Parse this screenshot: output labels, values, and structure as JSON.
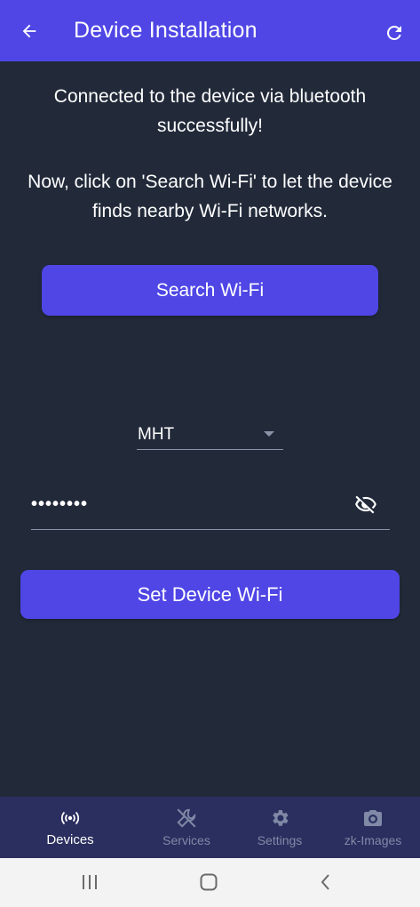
{
  "header": {
    "title": "Device Installation",
    "back_icon": "arrow-left-icon",
    "refresh_icon": "refresh-icon"
  },
  "message": {
    "line1": "Connected to the device via bluetooth successfully!",
    "line2": "Now, click on 'Search Wi-Fi' to let the device finds nearby Wi-Fi networks."
  },
  "search_button": {
    "label": "Search Wi-Fi"
  },
  "network_select": {
    "selected": "MHT"
  },
  "password": {
    "value": "••••••••",
    "visibility_icon": "eye-off-icon"
  },
  "set_button": {
    "label": "Set Device Wi-Fi"
  },
  "bottom_nav": {
    "items": [
      {
        "label": "Devices",
        "icon": "broadcast-icon",
        "active": true
      },
      {
        "label": "Services",
        "icon": "tools-icon",
        "active": false
      },
      {
        "label": "Settings",
        "icon": "gear-icon",
        "active": false
      },
      {
        "label": "zk-Images",
        "icon": "camera-icon",
        "active": false
      }
    ]
  },
  "colors": {
    "accent": "#4f46e5",
    "background": "#222a3a",
    "nav_background": "#2b2f5f"
  }
}
